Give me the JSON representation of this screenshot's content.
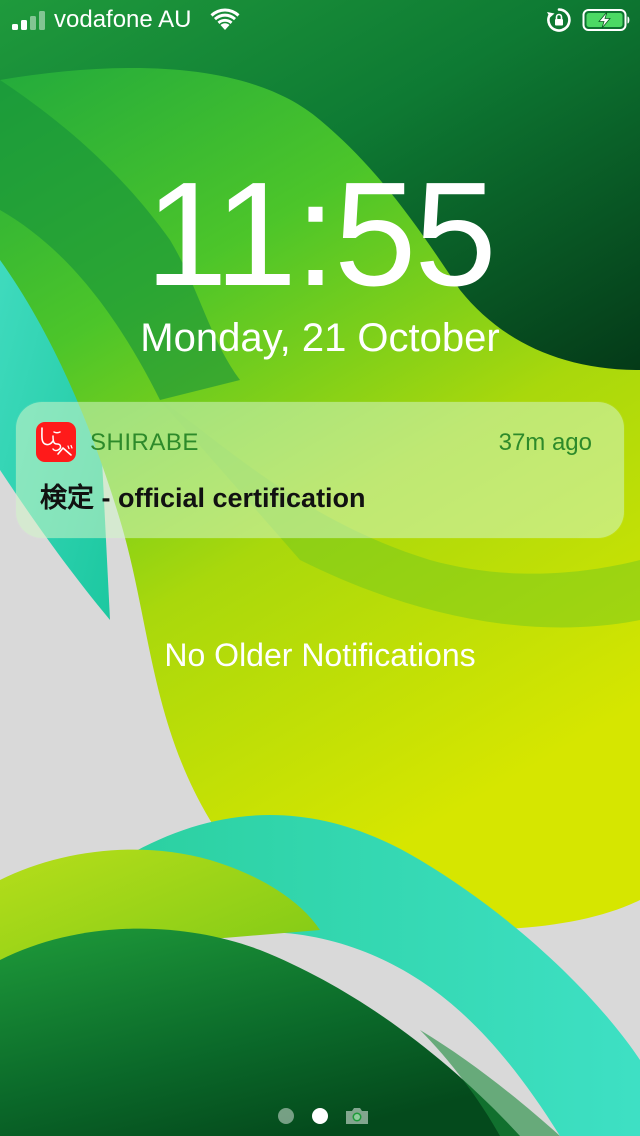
{
  "status_bar": {
    "carrier": "vodafone AU",
    "signal_bars": 4,
    "signal_bars_active": 2,
    "battery_state": "charging",
    "icons": [
      "signal-icon",
      "wifi-icon",
      "rotation-lock-icon",
      "battery-charging-icon"
    ]
  },
  "lock_screen": {
    "time": "11:55",
    "date": "Monday, 21 October"
  },
  "notification": {
    "app_name": "SHIRABE",
    "app_icon_text": "しらべ",
    "app_icon_color": "#ff1a1a",
    "time_ago": "37m ago",
    "body": "検定 - official certification"
  },
  "no_older_notifications": "No Older Notifications",
  "page_indicator": {
    "pages": 2,
    "active_page": 2,
    "extra_icon": "camera-icon"
  },
  "colors": {
    "accent_green": "#2d8a2a",
    "wallpaper_dark_green": "#0a5a2a",
    "wallpaper_lime": "#c8e000",
    "wallpaper_teal": "#2fd6b0"
  }
}
